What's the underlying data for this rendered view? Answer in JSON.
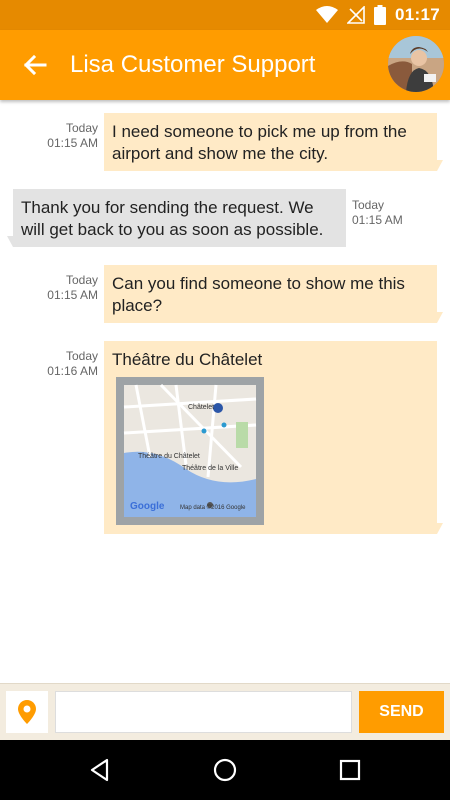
{
  "status_bar": {
    "time": "01:17",
    "icons": [
      "wifi-icon",
      "no-signal-icon",
      "battery-icon"
    ]
  },
  "header": {
    "title": "Lisa Customer Support",
    "back_icon": "arrow-back-icon",
    "avatar": "contact-avatar"
  },
  "messages": [
    {
      "direction": "outgoing",
      "day": "Today",
      "time": "01:15 AM",
      "text": "I need someone to pick me up from the airport and show me the city."
    },
    {
      "direction": "incoming",
      "day": "Today",
      "time": "01:15 AM",
      "text": "Thank you for sending the request. We will get back to you as soon as possible."
    },
    {
      "direction": "outgoing",
      "day": "Today",
      "time": "01:15 AM",
      "text": "Can you find someone to show me this place?"
    },
    {
      "direction": "outgoing",
      "day": "Today",
      "time": "01:16 AM",
      "text": "Théâtre du Châtelet",
      "map": {
        "labels": [
          "Châtelet",
          "Théâtre du Châtelet",
          "Théâtre de la Ville"
        ],
        "logo": "Google",
        "attribution": "Map data ©2016 Google"
      }
    }
  ],
  "composer": {
    "location_icon": "location-pin-icon",
    "input_value": "",
    "input_placeholder": "",
    "send_label": "SEND"
  },
  "nav_bar": {
    "icons": [
      "back-triangle-icon",
      "home-circle-icon",
      "recents-square-icon"
    ]
  },
  "colors": {
    "accent": "#ff9c00",
    "status_bar": "#e68a00",
    "outgoing_bubble": "#ffeac6",
    "incoming_bubble": "#e3e3e3"
  }
}
